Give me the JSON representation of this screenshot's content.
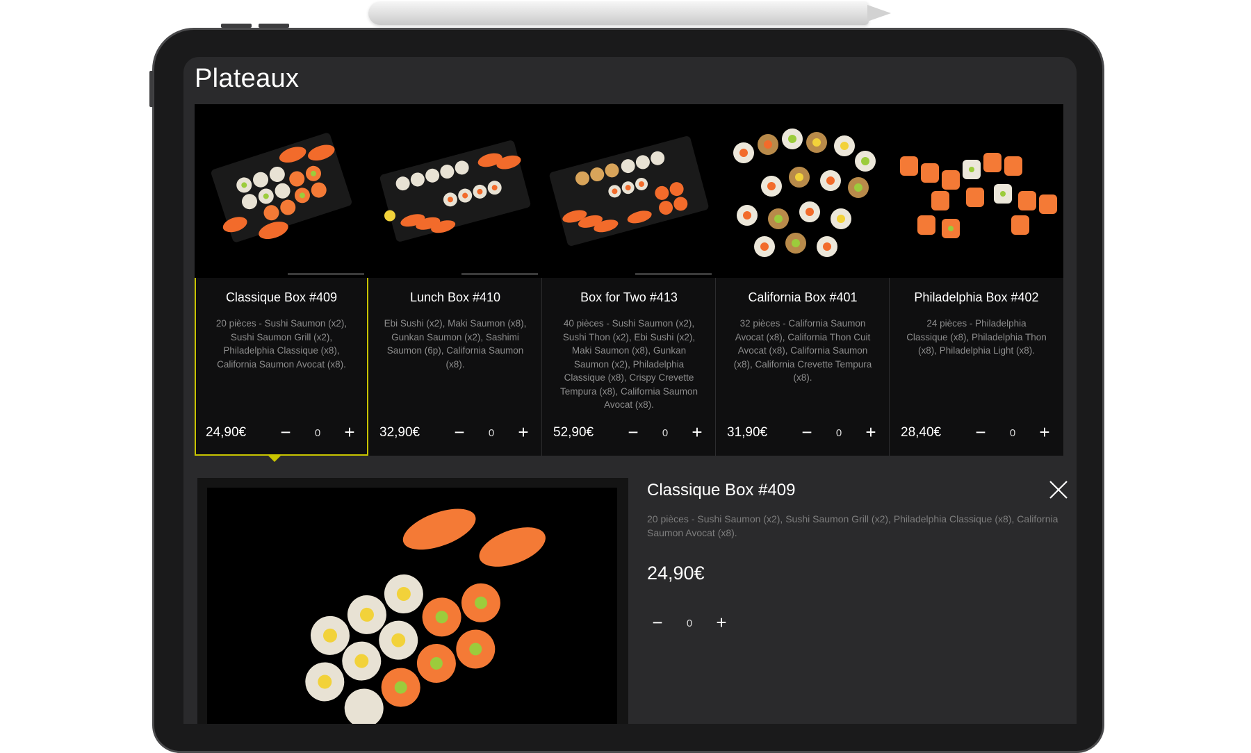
{
  "page_title": "Plateaux",
  "currency_note": "",
  "products": [
    {
      "name": "Classique Box #409",
      "description": "20 pièces - Sushi Saumon (x2), Sushi Saumon Grill (x2), Philadelphia Classique (x8), California Saumon Avocat (x8).",
      "price": "24,90€",
      "quantity": "0",
      "minus": "−",
      "plus": "+"
    },
    {
      "name": "Lunch Box #410",
      "description": "Ebi Sushi (x2), Maki Saumon (x8), Gunkan Saumon (x2), Sashimi Saumon (6p), California Saumon (x8).",
      "price": "32,90€",
      "quantity": "0",
      "minus": "−",
      "plus": "+"
    },
    {
      "name": "Box for Two #413",
      "description": "40 pièces - Sushi Saumon (x2), Sushi Thon (x2), Ebi Sushi (x2), Maki Saumon (x8), Gunkan Saumon (x2), Philadelphia Classique (x8), Crispy Crevette Tempura (x8), California Saumon Avocat (x8).",
      "price": "52,90€",
      "quantity": "0",
      "minus": "−",
      "plus": "+"
    },
    {
      "name": "California Box #401",
      "description": "32 pièces - California Saumon Avocat (x8), California Thon Cuit Avocat (x8), California Saumon (x8), California Crevette Tempura (x8).",
      "price": "31,90€",
      "quantity": "0",
      "minus": "−",
      "plus": "+"
    },
    {
      "name": "Philadelphia Box #402",
      "description": "24 pièces - Philadelphia Classique (x8), Philadelphia Thon (x8), Philadelphia Light (x8).",
      "price": "28,40€",
      "quantity": "0",
      "minus": "−",
      "plus": "+"
    }
  ],
  "detail": {
    "title": "Classique Box #409",
    "description": "20 pièces - Sushi Saumon (x2), Sushi Saumon Grill (x2), Philadelphia Classique (x8), California Saumon Avocat (x8).",
    "price": "24,90€",
    "quantity": "0",
    "minus": "−",
    "plus": "+"
  },
  "icons": {
    "close": "close-icon",
    "minus": "minus-icon",
    "plus": "plus-icon"
  },
  "colors": {
    "selected_accent": "#c8c400",
    "card_background": "#0f0f10",
    "screen_background": "#2a2a2c",
    "salmon": "#f26b2b"
  }
}
